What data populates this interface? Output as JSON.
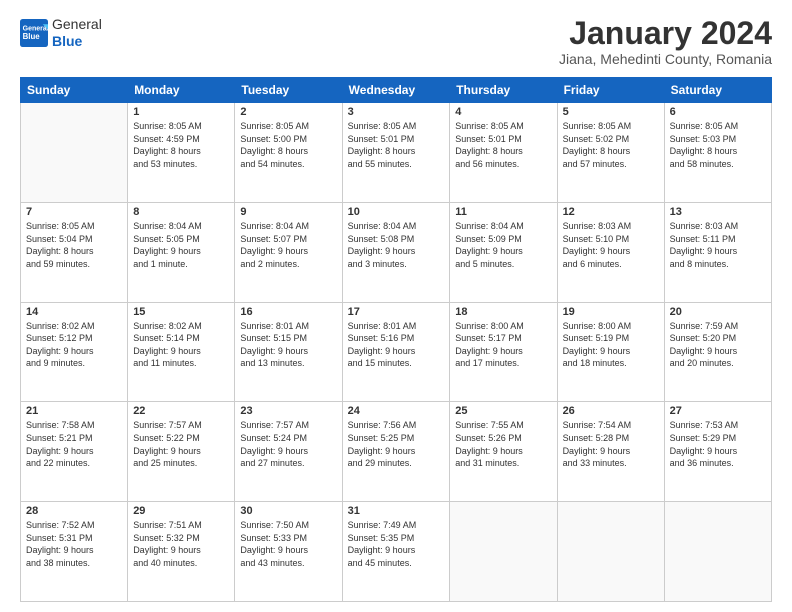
{
  "header": {
    "logo_general": "General",
    "logo_blue": "Blue",
    "title": "January 2024",
    "subtitle": "Jiana, Mehedinti County, Romania"
  },
  "calendar": {
    "days_of_week": [
      "Sunday",
      "Monday",
      "Tuesday",
      "Wednesday",
      "Thursday",
      "Friday",
      "Saturday"
    ],
    "weeks": [
      [
        {
          "day": "",
          "info": ""
        },
        {
          "day": "1",
          "info": "Sunrise: 8:05 AM\nSunset: 4:59 PM\nDaylight: 8 hours\nand 53 minutes."
        },
        {
          "day": "2",
          "info": "Sunrise: 8:05 AM\nSunset: 5:00 PM\nDaylight: 8 hours\nand 54 minutes."
        },
        {
          "day": "3",
          "info": "Sunrise: 8:05 AM\nSunset: 5:01 PM\nDaylight: 8 hours\nand 55 minutes."
        },
        {
          "day": "4",
          "info": "Sunrise: 8:05 AM\nSunset: 5:01 PM\nDaylight: 8 hours\nand 56 minutes."
        },
        {
          "day": "5",
          "info": "Sunrise: 8:05 AM\nSunset: 5:02 PM\nDaylight: 8 hours\nand 57 minutes."
        },
        {
          "day": "6",
          "info": "Sunrise: 8:05 AM\nSunset: 5:03 PM\nDaylight: 8 hours\nand 58 minutes."
        }
      ],
      [
        {
          "day": "7",
          "info": "Sunrise: 8:05 AM\nSunset: 5:04 PM\nDaylight: 8 hours\nand 59 minutes."
        },
        {
          "day": "8",
          "info": "Sunrise: 8:04 AM\nSunset: 5:05 PM\nDaylight: 9 hours\nand 1 minute."
        },
        {
          "day": "9",
          "info": "Sunrise: 8:04 AM\nSunset: 5:07 PM\nDaylight: 9 hours\nand 2 minutes."
        },
        {
          "day": "10",
          "info": "Sunrise: 8:04 AM\nSunset: 5:08 PM\nDaylight: 9 hours\nand 3 minutes."
        },
        {
          "day": "11",
          "info": "Sunrise: 8:04 AM\nSunset: 5:09 PM\nDaylight: 9 hours\nand 5 minutes."
        },
        {
          "day": "12",
          "info": "Sunrise: 8:03 AM\nSunset: 5:10 PM\nDaylight: 9 hours\nand 6 minutes."
        },
        {
          "day": "13",
          "info": "Sunrise: 8:03 AM\nSunset: 5:11 PM\nDaylight: 9 hours\nand 8 minutes."
        }
      ],
      [
        {
          "day": "14",
          "info": "Sunrise: 8:02 AM\nSunset: 5:12 PM\nDaylight: 9 hours\nand 9 minutes."
        },
        {
          "day": "15",
          "info": "Sunrise: 8:02 AM\nSunset: 5:14 PM\nDaylight: 9 hours\nand 11 minutes."
        },
        {
          "day": "16",
          "info": "Sunrise: 8:01 AM\nSunset: 5:15 PM\nDaylight: 9 hours\nand 13 minutes."
        },
        {
          "day": "17",
          "info": "Sunrise: 8:01 AM\nSunset: 5:16 PM\nDaylight: 9 hours\nand 15 minutes."
        },
        {
          "day": "18",
          "info": "Sunrise: 8:00 AM\nSunset: 5:17 PM\nDaylight: 9 hours\nand 17 minutes."
        },
        {
          "day": "19",
          "info": "Sunrise: 8:00 AM\nSunset: 5:19 PM\nDaylight: 9 hours\nand 18 minutes."
        },
        {
          "day": "20",
          "info": "Sunrise: 7:59 AM\nSunset: 5:20 PM\nDaylight: 9 hours\nand 20 minutes."
        }
      ],
      [
        {
          "day": "21",
          "info": "Sunrise: 7:58 AM\nSunset: 5:21 PM\nDaylight: 9 hours\nand 22 minutes."
        },
        {
          "day": "22",
          "info": "Sunrise: 7:57 AM\nSunset: 5:22 PM\nDaylight: 9 hours\nand 25 minutes."
        },
        {
          "day": "23",
          "info": "Sunrise: 7:57 AM\nSunset: 5:24 PM\nDaylight: 9 hours\nand 27 minutes."
        },
        {
          "day": "24",
          "info": "Sunrise: 7:56 AM\nSunset: 5:25 PM\nDaylight: 9 hours\nand 29 minutes."
        },
        {
          "day": "25",
          "info": "Sunrise: 7:55 AM\nSunset: 5:26 PM\nDaylight: 9 hours\nand 31 minutes."
        },
        {
          "day": "26",
          "info": "Sunrise: 7:54 AM\nSunset: 5:28 PM\nDaylight: 9 hours\nand 33 minutes."
        },
        {
          "day": "27",
          "info": "Sunrise: 7:53 AM\nSunset: 5:29 PM\nDaylight: 9 hours\nand 36 minutes."
        }
      ],
      [
        {
          "day": "28",
          "info": "Sunrise: 7:52 AM\nSunset: 5:31 PM\nDaylight: 9 hours\nand 38 minutes."
        },
        {
          "day": "29",
          "info": "Sunrise: 7:51 AM\nSunset: 5:32 PM\nDaylight: 9 hours\nand 40 minutes."
        },
        {
          "day": "30",
          "info": "Sunrise: 7:50 AM\nSunset: 5:33 PM\nDaylight: 9 hours\nand 43 minutes."
        },
        {
          "day": "31",
          "info": "Sunrise: 7:49 AM\nSunset: 5:35 PM\nDaylight: 9 hours\nand 45 minutes."
        },
        {
          "day": "",
          "info": ""
        },
        {
          "day": "",
          "info": ""
        },
        {
          "day": "",
          "info": ""
        }
      ]
    ]
  }
}
